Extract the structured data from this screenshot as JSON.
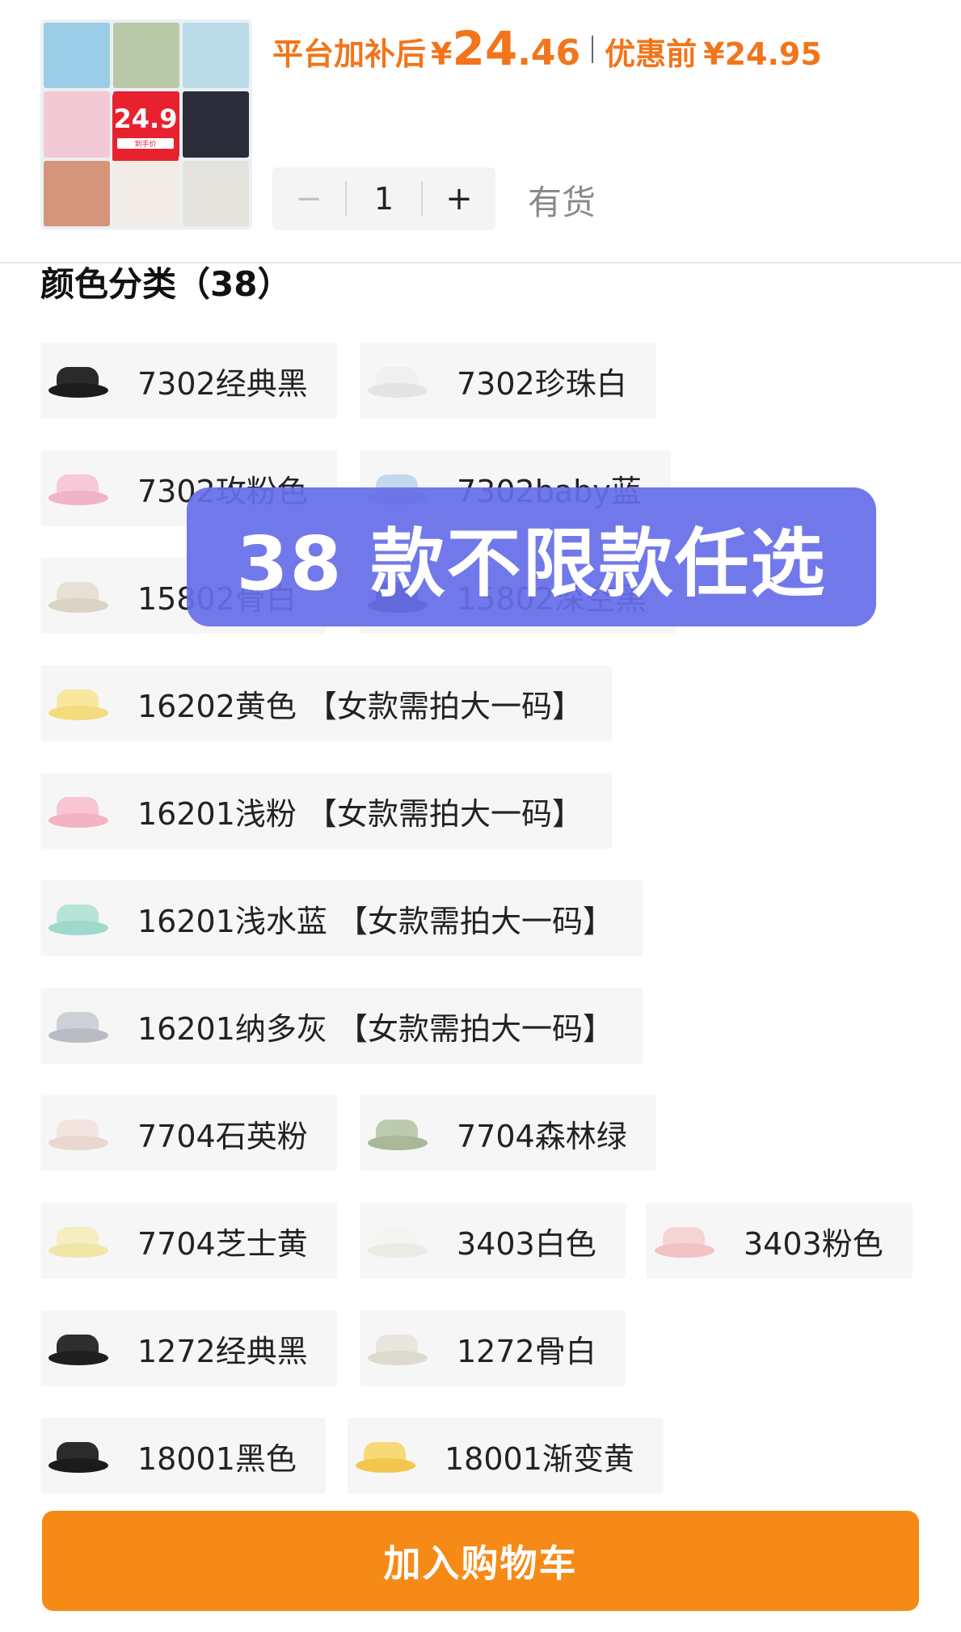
{
  "product": {
    "badge_price": "24.9",
    "badge_tag": "到手价",
    "thumb_colors": [
      "#9ccde6",
      "#b9c9a8",
      "#bcdbe8",
      "#f4c9d6",
      "#e8212f",
      "#2b2b3a",
      "#d4957a",
      "#f1ece6",
      "#e5e3dd"
    ]
  },
  "price": {
    "subsidy_label": "平台加补后",
    "currency": "¥",
    "subsidy_int": "24",
    "subsidy_dec": ".46",
    "original_label": "优惠前",
    "original_price": "¥24.95",
    "accent_color": "#f2751b"
  },
  "quantity": {
    "minus": "−",
    "value": "1",
    "plus": "+"
  },
  "stock_status": "有货",
  "color_section": {
    "title": "颜色分类（38）"
  },
  "options": [
    {
      "label": "7302经典黑",
      "sole": "#1c1c1c",
      "upper": "#2a2a2a"
    },
    {
      "label": "7302珍珠白",
      "sole": "#e4e4e4",
      "upper": "#f0f0f0"
    },
    {
      "label": "7302玫粉色",
      "sole": "#f0b3c8",
      "upper": "#f7c9d9"
    },
    {
      "label": "7302baby蓝",
      "sole": "#aac8e6",
      "upper": "#c2d8ee"
    },
    {
      "label": "15802骨白",
      "sole": "#d9d4c6",
      "upper": "#e6e1d4"
    },
    {
      "label": "15802深空黑",
      "sole": "#2b2b2b",
      "upper": "#383838"
    },
    {
      "label": "16202黄色 【女款需拍大一码】",
      "sole": "#f4dc7e",
      "upper": "#f8e79c"
    },
    {
      "label": "16201浅粉 【女款需拍大一码】",
      "sole": "#f4b2c2",
      "upper": "#f7c6d2"
    },
    {
      "label": "16201浅水蓝 【女款需拍大一码】",
      "sole": "#9fd9cc",
      "upper": "#b6e4d9"
    },
    {
      "label": "16201纳多灰 【女款需拍大一码】",
      "sole": "#b9bcc4",
      "upper": "#cdd0d6"
    },
    {
      "label": "7704石英粉",
      "sole": "#ead7d2",
      "upper": "#f3e4df"
    },
    {
      "label": "7704森林绿",
      "sole": "#a8b898",
      "upper": "#bccaad"
    },
    {
      "label": "7704芝士黄",
      "sole": "#f1e6a8",
      "upper": "#f6eec0"
    },
    {
      "label": "3403白色",
      "sole": "#ebebe6",
      "upper": "#f4f4f0"
    },
    {
      "label": "3403粉色",
      "sole": "#f1c3c3",
      "upper": "#f6d4d4"
    },
    {
      "label": "1272经典黑",
      "sole": "#1f1f1f",
      "upper": "#2e2e2e"
    },
    {
      "label": "1272骨白",
      "sole": "#dedad0",
      "upper": "#e9e6de"
    },
    {
      "label": "18001黑色",
      "sole": "#1b1b1b",
      "upper": "#2b2b2b"
    },
    {
      "label": "18001渐变黄",
      "sole": "#f3c74e",
      "upper": "#f7d978"
    }
  ],
  "overlay_banner": "38 款不限款任选",
  "add_to_cart": "加入购物车"
}
